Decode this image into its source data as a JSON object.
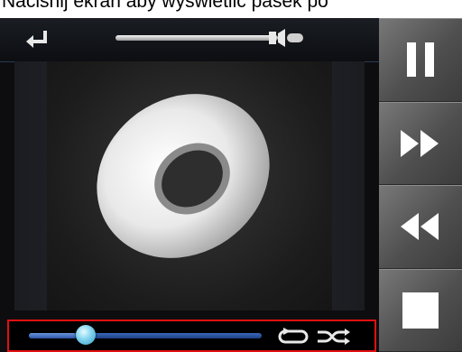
{
  "banner": {
    "text": "Naciśnij ekran aby wyświetlić pasek po"
  },
  "player": {
    "volume": 0.92,
    "progress": 0.2,
    "icons": {
      "back": "return-arrow-icon",
      "volume": "speaker-icon",
      "repeat": "repeat-icon",
      "shuffle": "shuffle-icon",
      "art": "disc-icon"
    },
    "highlight_color": "#e01010",
    "track_color": "#2c55a3",
    "thumb_color": "#7fd2ee"
  },
  "side_buttons": [
    {
      "icon": "pause-icon"
    },
    {
      "icon": "fast-forward-icon"
    },
    {
      "icon": "rewind-icon"
    },
    {
      "icon": "stop-icon"
    }
  ]
}
